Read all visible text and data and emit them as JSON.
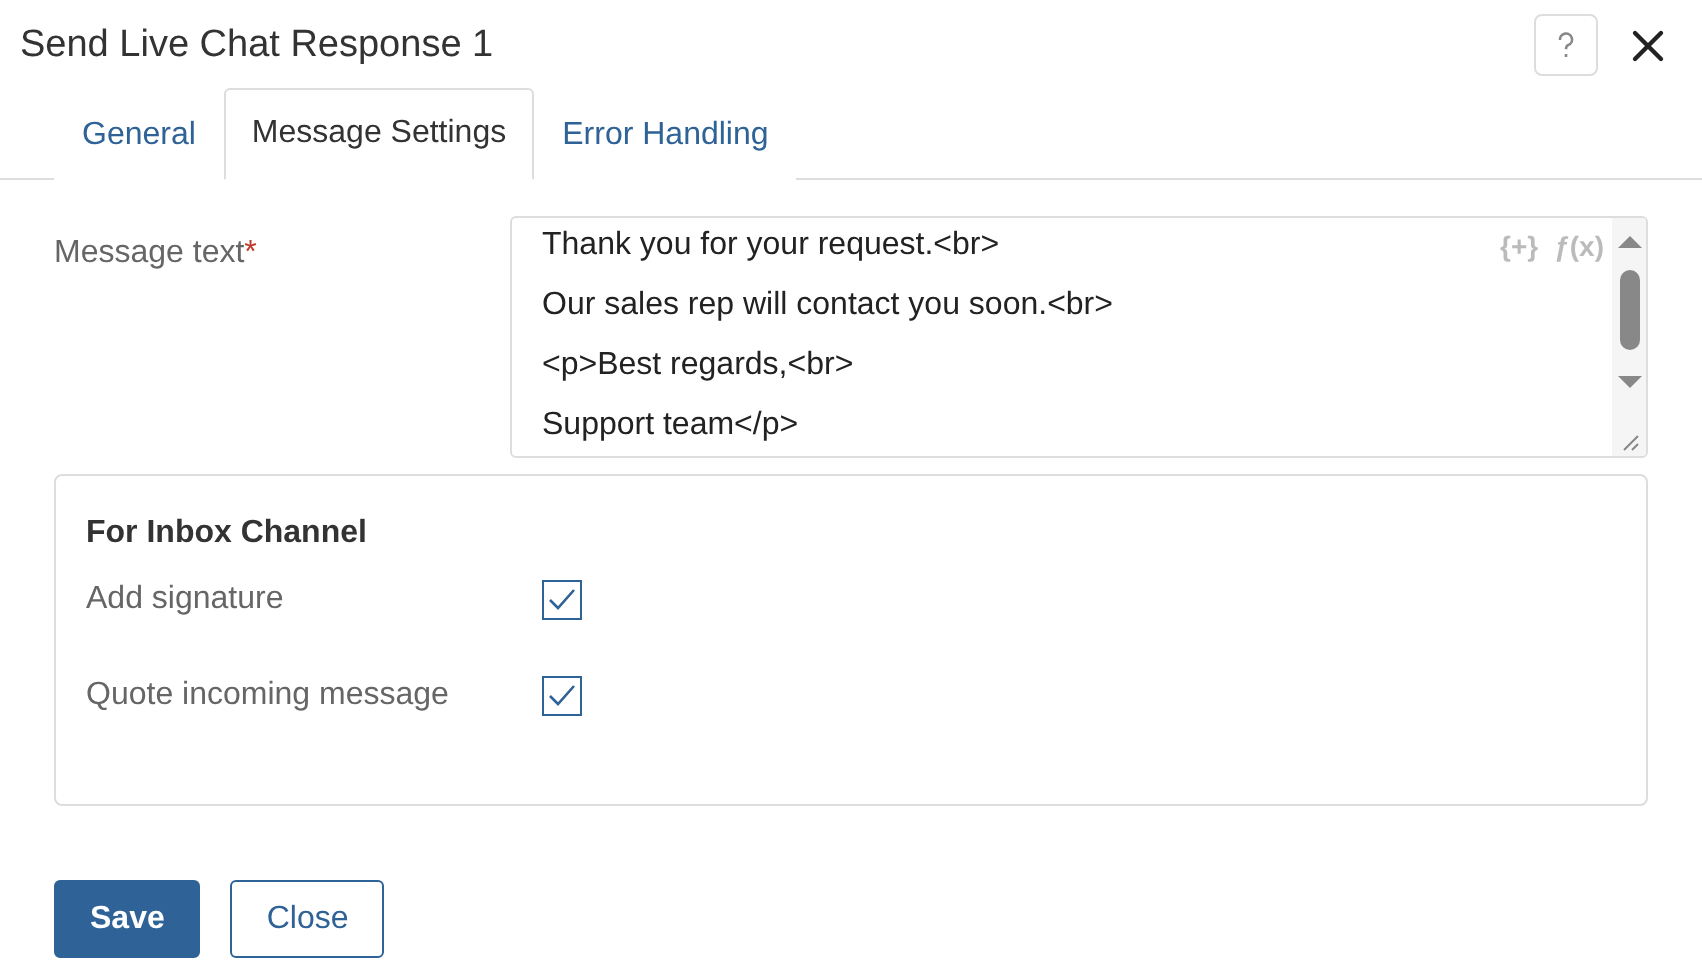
{
  "window": {
    "title": "Send Live Chat Response 1"
  },
  "tabs": [
    {
      "label": "General",
      "selected": false
    },
    {
      "label": "Message Settings",
      "selected": true
    },
    {
      "label": "Error Handling",
      "selected": false
    }
  ],
  "message": {
    "label": "Message text",
    "required_mark": "*",
    "lines": [
      "Thank you for your request.<br>",
      "Our sales rep will contact you soon.<br>",
      "<p>Best regards,<br>",
      "Support team</p>"
    ],
    "insert_variable": "{+}",
    "function": "ƒ(x)"
  },
  "inbox_channel": {
    "title": "For Inbox Channel",
    "options": [
      {
        "label": "Add signature",
        "checked": true
      },
      {
        "label": "Quote incoming message",
        "checked": true
      }
    ]
  },
  "buttons": [
    {
      "label": "Save",
      "kind": "primary"
    },
    {
      "label": "Close",
      "kind": "secondary"
    }
  ]
}
